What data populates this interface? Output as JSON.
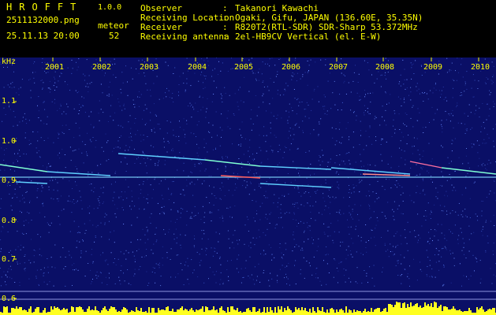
{
  "header": {
    "app_title": "HROFFT",
    "app_version": "1.0.0",
    "filename": "2511132000.png",
    "meteor_label": "meteor",
    "datetime": "25.11.13 20:00",
    "meteor_count": "52"
  },
  "info": [
    {
      "key": "Observer",
      "value": "Takanori Kawachi"
    },
    {
      "key": "Receiving Location",
      "value": "Ogaki, Gifu, JAPAN (136.60E, 35.35N)"
    },
    {
      "key": "Receiver",
      "value": "R820T2(RTL-SDR) SDR-Sharp 53.372MHz"
    },
    {
      "key": "Receiving antenna",
      "value": "2el-HB9CV Vertical (el. E-W)"
    }
  ],
  "plot": {
    "y_unit_label": "kHz",
    "x_labels": [
      "2001",
      "2002",
      "2003",
      "2004",
      "2005",
      "2006",
      "2007",
      "2008",
      "2009",
      "2010"
    ],
    "y_labels": [
      "1.1",
      "1.0",
      "0.9",
      "0.8",
      "0.7",
      "0.6"
    ],
    "background_color": "#0a0f66",
    "label_color": "#ffff00"
  }
}
